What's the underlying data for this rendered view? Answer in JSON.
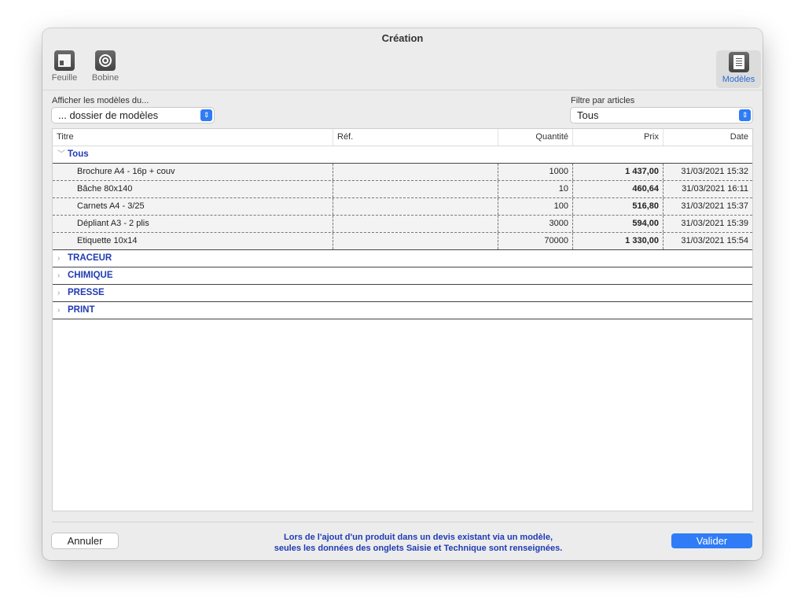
{
  "window": {
    "title": "Création"
  },
  "toolbar": {
    "feuille": {
      "label": "Feuille",
      "icon": "sheet-layout-icon"
    },
    "bobine": {
      "label": "Bobine",
      "icon": "roll-icon"
    },
    "modeles": {
      "label": "Modèles",
      "icon": "templates-icon",
      "selected": true
    }
  },
  "filters": {
    "folder": {
      "label": "Afficher les modèles du...",
      "value": "... dossier de modèles"
    },
    "articles": {
      "label": "Filtre par articles",
      "value": "Tous"
    }
  },
  "table": {
    "columns": [
      "Titre",
      "Réf.",
      "Quantité",
      "Prix",
      "Date"
    ],
    "groups": [
      {
        "name": "Tous",
        "expanded": true,
        "rows": [
          {
            "titre": "Brochure A4 - 16p + couv",
            "ref": "",
            "quantite": "1000",
            "prix": "1 437,00",
            "date": "31/03/2021 15:32"
          },
          {
            "titre": "Bâche 80x140",
            "ref": "",
            "quantite": "10",
            "prix": "460,64",
            "date": "31/03/2021 16:11"
          },
          {
            "titre": "Carnets A4 - 3/25",
            "ref": "",
            "quantite": "100",
            "prix": "516,80",
            "date": "31/03/2021 15:37"
          },
          {
            "titre": "Dépliant A3 - 2 plis",
            "ref": "",
            "quantite": "3000",
            "prix": "594,00",
            "date": "31/03/2021 15:39"
          },
          {
            "titre": "Etiquette 10x14",
            "ref": "",
            "quantite": "70000",
            "prix": "1 330,00",
            "date": "31/03/2021 15:54"
          }
        ]
      },
      {
        "name": "TRACEUR",
        "expanded": false,
        "rows": []
      },
      {
        "name": "CHIMIQUE",
        "expanded": false,
        "rows": []
      },
      {
        "name": "PRESSE",
        "expanded": false,
        "rows": []
      },
      {
        "name": "PRINT",
        "expanded": false,
        "rows": []
      }
    ]
  },
  "footer": {
    "cancel_label": "Annuler",
    "ok_label": "Valider",
    "note_line1": "Lors de l'ajout d'un produit dans un devis existant via un modèle,",
    "note_line2": "seules les données des onglets Saisie et Technique sont renseignées."
  },
  "colors": {
    "accent": "#2f7cf6",
    "group_text": "#1f3bb3",
    "selected_tool": "#2a6cd6"
  }
}
